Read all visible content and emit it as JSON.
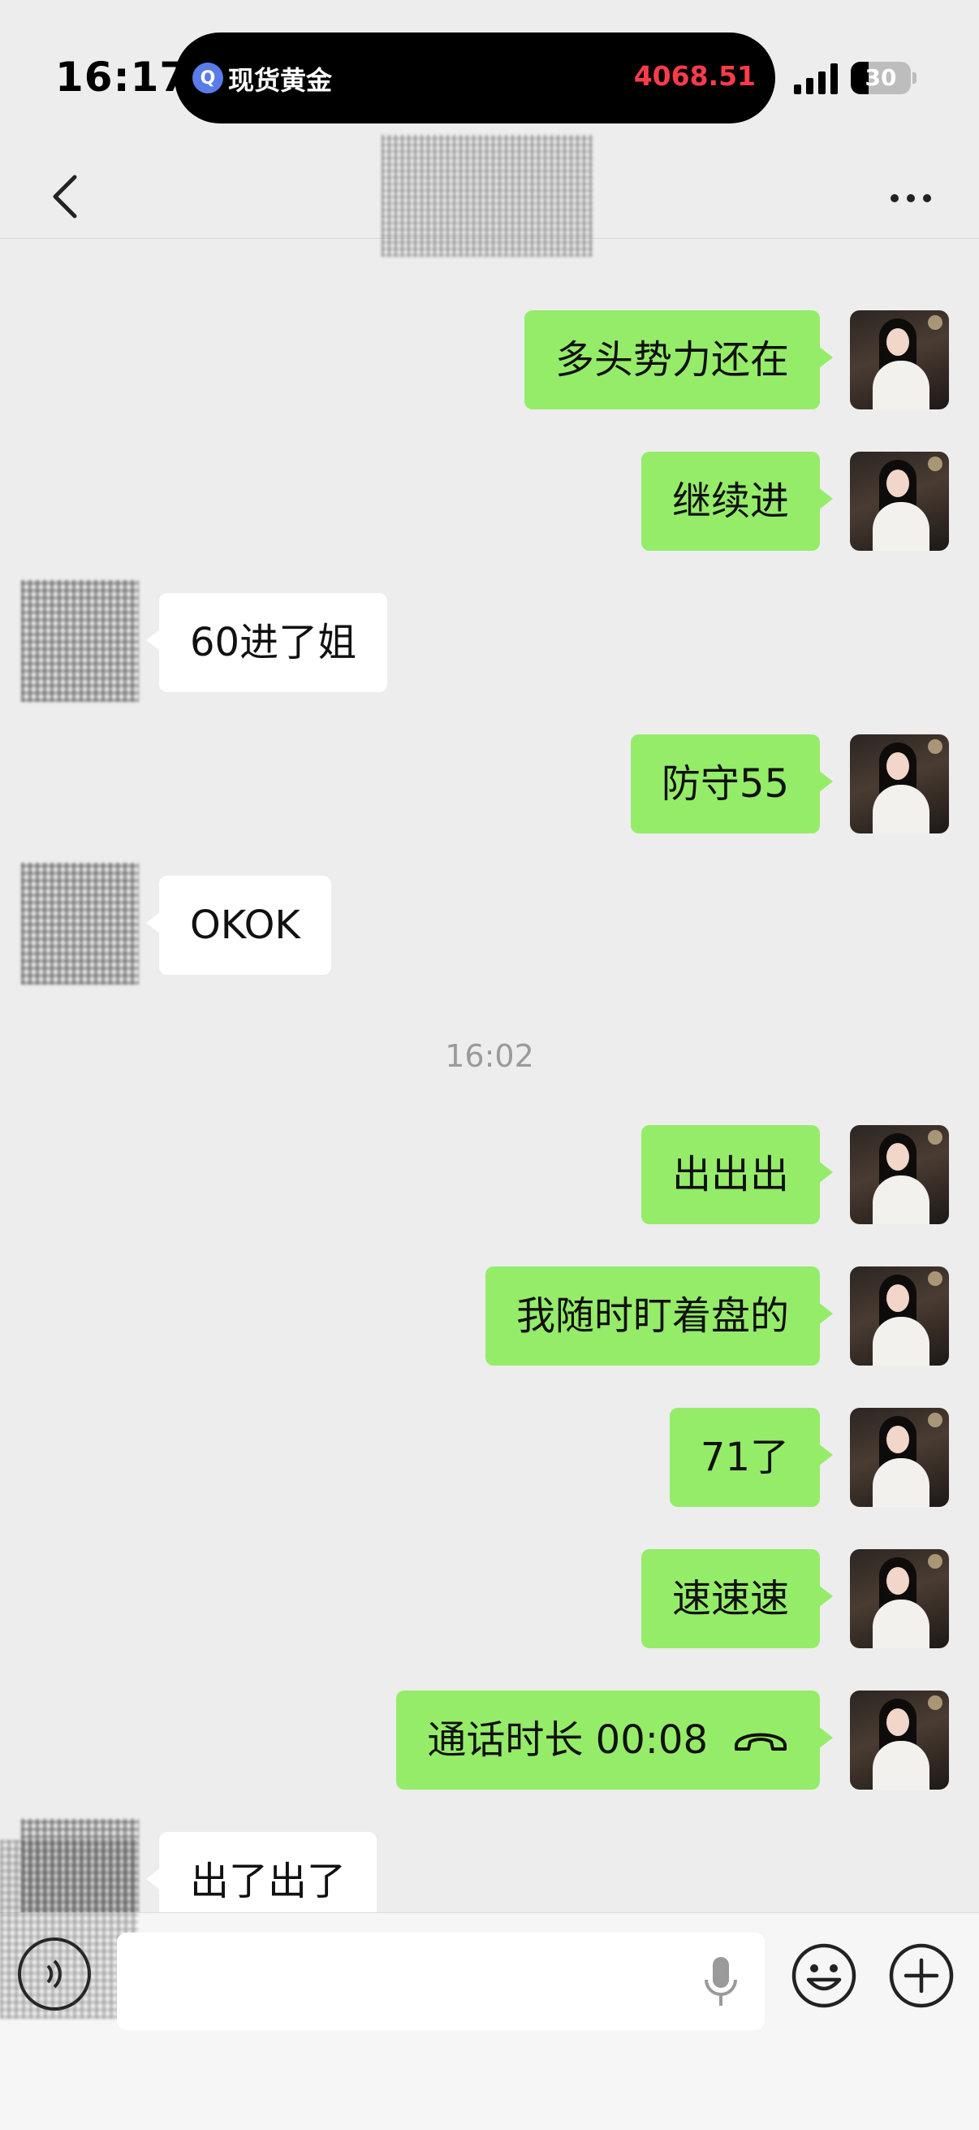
{
  "status_bar": {
    "time": "16:17",
    "live_activity": {
      "icon_letter": "Q",
      "name": "现货黄金",
      "price": "4068.51",
      "price_color": "#ff3b4a"
    },
    "battery": "30"
  },
  "nav": {
    "back_icon": "chevron-left-icon",
    "more_icon": "more-icon"
  },
  "colors": {
    "background": "#ededed",
    "my_bubble": "#95ec69",
    "other_bubble": "#ffffff"
  },
  "messages": [
    {
      "sender": "me",
      "text": "多头势力还在"
    },
    {
      "sender": "me",
      "text": "继续进"
    },
    {
      "sender": "other",
      "text": "60进了姐"
    },
    {
      "sender": "me",
      "text": "防守55"
    },
    {
      "sender": "other",
      "text": "OKOK"
    },
    {
      "timestamp": "16:02"
    },
    {
      "sender": "me",
      "text": "出出出"
    },
    {
      "sender": "me",
      "text": "我随时盯着盘的"
    },
    {
      "sender": "me",
      "text": "71了"
    },
    {
      "sender": "me",
      "text": "速速速"
    },
    {
      "sender": "me",
      "type": "call",
      "text": "通话时长 00:08",
      "icon": "phone-hangup-icon"
    },
    {
      "sender": "other",
      "text": "出了出了"
    }
  ],
  "input_bar": {
    "value": "",
    "placeholder": "",
    "icons": [
      "voice-icon",
      "mic-icon",
      "emoji-icon",
      "plus-icon"
    ]
  }
}
